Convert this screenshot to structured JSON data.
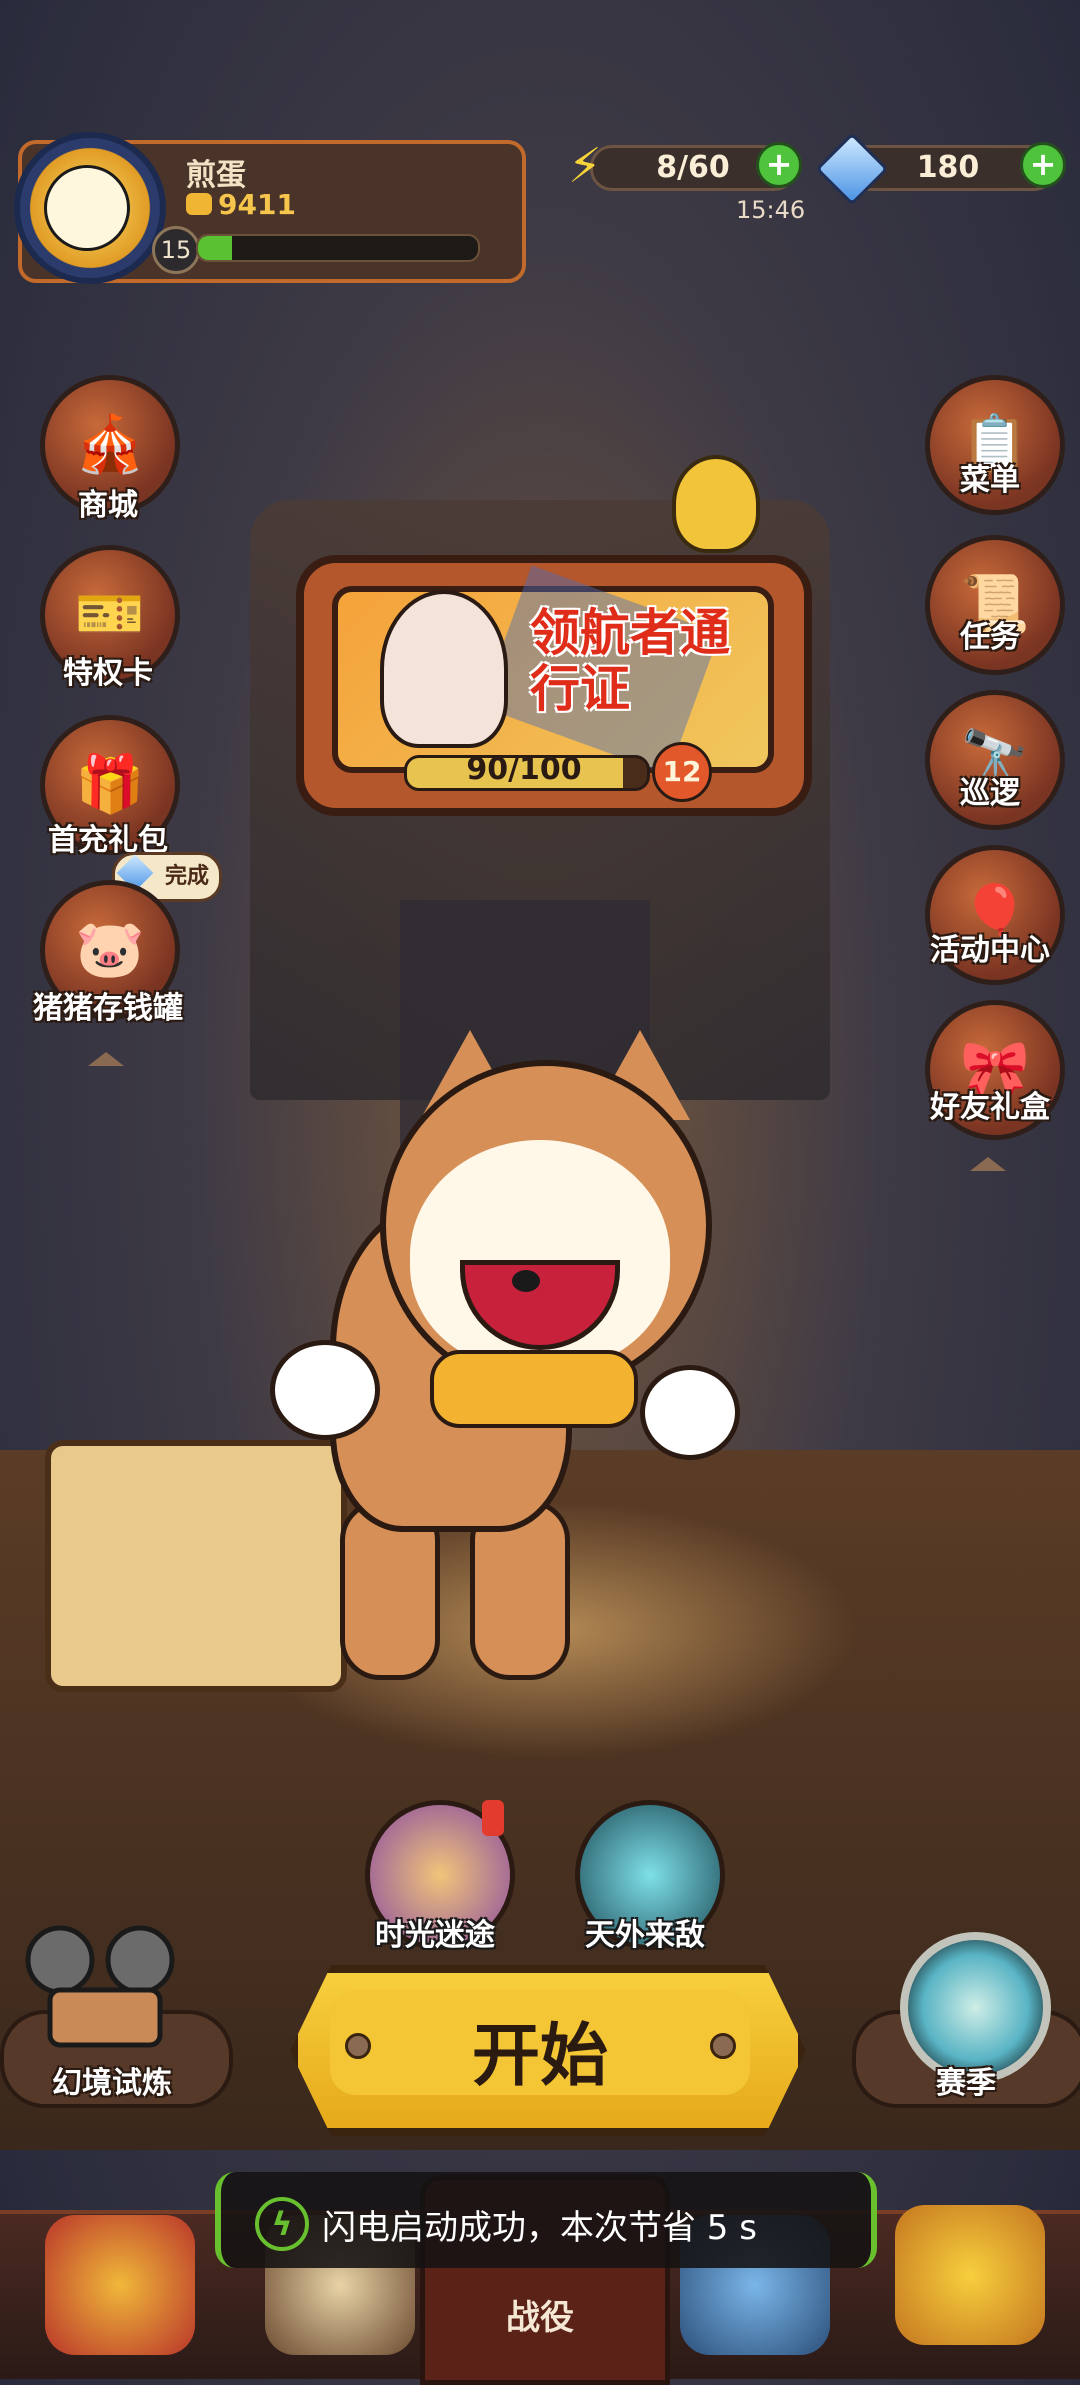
{
  "player": {
    "name": "煎蛋",
    "coins": "9411",
    "level": "15",
    "xp_progress": 0.12
  },
  "resources": {
    "energy": "8/60",
    "energy_timer": "15:46",
    "gems": "180",
    "plus": "+"
  },
  "left_menu": [
    {
      "label": "商城",
      "icon": "circus-tent-icon"
    },
    {
      "label": "特权卡",
      "icon": "vip-card-icon"
    },
    {
      "label": "首充礼包",
      "icon": "gift-box-icon"
    },
    {
      "label": "猪猪存钱罐",
      "icon": "piggy-bank-icon"
    }
  ],
  "complete_badge": "完成",
  "right_menu": [
    {
      "label": "菜单",
      "icon": "menu-board-icon"
    },
    {
      "label": "任务",
      "icon": "scroll-icon"
    },
    {
      "label": "巡逻",
      "icon": "telescope-icon"
    },
    {
      "label": "活动中心",
      "icon": "balloons-icon"
    },
    {
      "label": "好友礼盒",
      "icon": "friend-gift-icon"
    }
  ],
  "battle_pass": {
    "title": "领航者通行证",
    "progress": "90/100",
    "progress_value": 0.9,
    "level": "12"
  },
  "modes": {
    "left": "时光迷途",
    "right": "天外来敌"
  },
  "start_button": "开始",
  "trial": "幻境试炼",
  "season": "赛季",
  "toast": {
    "icon": "lightning-icon",
    "text": "闪电启动成功，本次节省 5 s"
  },
  "bottom_nav": {
    "center": "战役"
  },
  "colors": {
    "accent": "#f4c534",
    "energy_plus": "#4ec33b",
    "toast_border": "#69c02f",
    "pass_title": "#e02d1a"
  }
}
